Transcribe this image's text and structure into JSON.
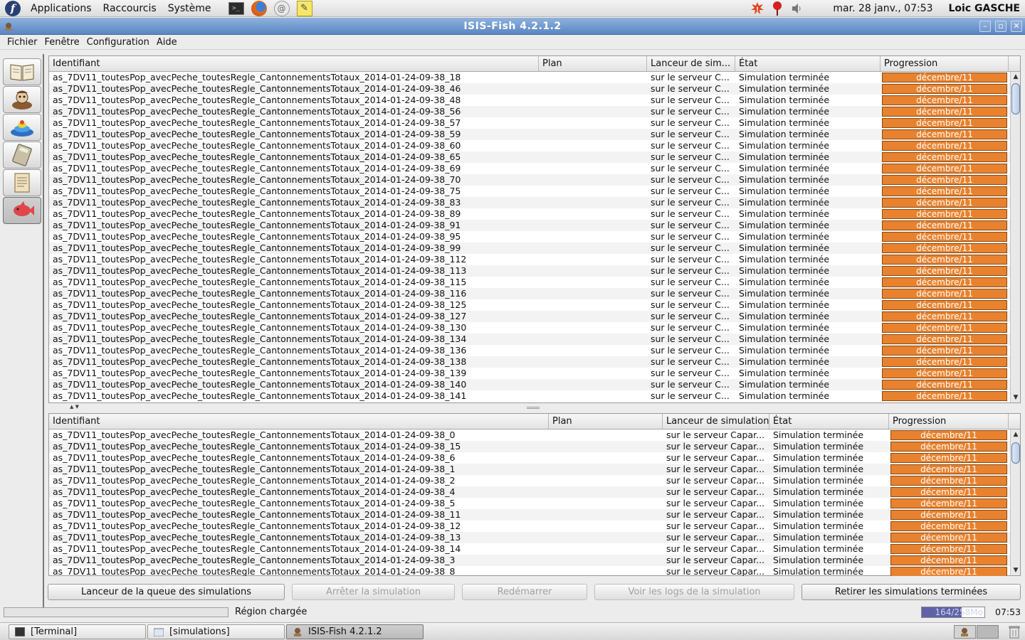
{
  "top_panel": {
    "menus": [
      "Applications",
      "Raccourcis",
      "Système"
    ],
    "launchers": [
      "terminal-icon",
      "firefox-icon",
      "mail-icon",
      "notes-icon"
    ],
    "tray": [
      "update-alert-icon",
      "notification-icon",
      "volume-icon"
    ],
    "clock": "mar. 28 janv., 07:53",
    "user": "Loic GASCHE"
  },
  "window": {
    "title": "ISIS-Fish 4.2.1.2"
  },
  "menubar": [
    "Fichier",
    "Fenêtre",
    "Configuration",
    "Aide"
  ],
  "toolbar": [
    "book-icon",
    "fisherman-icon",
    "sea-map-icon",
    "calculator-icon",
    "report-icon",
    "fish-icon"
  ],
  "top_table": {
    "headers": [
      "Identifiant",
      "Plan",
      "Lanceur de sim...",
      "État",
      "Progression"
    ],
    "rows": [
      [
        "as_7DV11_toutesPop_avecPeche_toutesRegle_CantonnementsTotaux_2014-01-24-09-38_18",
        "",
        "sur le serveur C...",
        "Simulation terminée",
        "décembre/11"
      ],
      [
        "as_7DV11_toutesPop_avecPeche_toutesRegle_CantonnementsTotaux_2014-01-24-09-38_46",
        "",
        "sur le serveur C...",
        "Simulation terminée",
        "décembre/11"
      ],
      [
        "as_7DV11_toutesPop_avecPeche_toutesRegle_CantonnementsTotaux_2014-01-24-09-38_48",
        "",
        "sur le serveur C...",
        "Simulation terminée",
        "décembre/11"
      ],
      [
        "as_7DV11_toutesPop_avecPeche_toutesRegle_CantonnementsTotaux_2014-01-24-09-38_56",
        "",
        "sur le serveur C...",
        "Simulation terminée",
        "décembre/11"
      ],
      [
        "as_7DV11_toutesPop_avecPeche_toutesRegle_CantonnementsTotaux_2014-01-24-09-38_57",
        "",
        "sur le serveur C...",
        "Simulation terminée",
        "décembre/11"
      ],
      [
        "as_7DV11_toutesPop_avecPeche_toutesRegle_CantonnementsTotaux_2014-01-24-09-38_59",
        "",
        "sur le serveur C...",
        "Simulation terminée",
        "décembre/11"
      ],
      [
        "as_7DV11_toutesPop_avecPeche_toutesRegle_CantonnementsTotaux_2014-01-24-09-38_60",
        "",
        "sur le serveur C...",
        "Simulation terminée",
        "décembre/11"
      ],
      [
        "as_7DV11_toutesPop_avecPeche_toutesRegle_CantonnementsTotaux_2014-01-24-09-38_65",
        "",
        "sur le serveur C...",
        "Simulation terminée",
        "décembre/11"
      ],
      [
        "as_7DV11_toutesPop_avecPeche_toutesRegle_CantonnementsTotaux_2014-01-24-09-38_69",
        "",
        "sur le serveur C...",
        "Simulation terminée",
        "décembre/11"
      ],
      [
        "as_7DV11_toutesPop_avecPeche_toutesRegle_CantonnementsTotaux_2014-01-24-09-38_70",
        "",
        "sur le serveur C...",
        "Simulation terminée",
        "décembre/11"
      ],
      [
        "as_7DV11_toutesPop_avecPeche_toutesRegle_CantonnementsTotaux_2014-01-24-09-38_75",
        "",
        "sur le serveur C...",
        "Simulation terminée",
        "décembre/11"
      ],
      [
        "as_7DV11_toutesPop_avecPeche_toutesRegle_CantonnementsTotaux_2014-01-24-09-38_83",
        "",
        "sur le serveur C...",
        "Simulation terminée",
        "décembre/11"
      ],
      [
        "as_7DV11_toutesPop_avecPeche_toutesRegle_CantonnementsTotaux_2014-01-24-09-38_89",
        "",
        "sur le serveur C...",
        "Simulation terminée",
        "décembre/11"
      ],
      [
        "as_7DV11_toutesPop_avecPeche_toutesRegle_CantonnementsTotaux_2014-01-24-09-38_91",
        "",
        "sur le serveur C...",
        "Simulation terminée",
        "décembre/11"
      ],
      [
        "as_7DV11_toutesPop_avecPeche_toutesRegle_CantonnementsTotaux_2014-01-24-09-38_95",
        "",
        "sur le serveur C...",
        "Simulation terminée",
        "décembre/11"
      ],
      [
        "as_7DV11_toutesPop_avecPeche_toutesRegle_CantonnementsTotaux_2014-01-24-09-38_99",
        "",
        "sur le serveur C...",
        "Simulation terminée",
        "décembre/11"
      ],
      [
        "as_7DV11_toutesPop_avecPeche_toutesRegle_CantonnementsTotaux_2014-01-24-09-38_112",
        "",
        "sur le serveur C...",
        "Simulation terminée",
        "décembre/11"
      ],
      [
        "as_7DV11_toutesPop_avecPeche_toutesRegle_CantonnementsTotaux_2014-01-24-09-38_113",
        "",
        "sur le serveur C...",
        "Simulation terminée",
        "décembre/11"
      ],
      [
        "as_7DV11_toutesPop_avecPeche_toutesRegle_CantonnementsTotaux_2014-01-24-09-38_115",
        "",
        "sur le serveur C...",
        "Simulation terminée",
        "décembre/11"
      ],
      [
        "as_7DV11_toutesPop_avecPeche_toutesRegle_CantonnementsTotaux_2014-01-24-09-38_116",
        "",
        "sur le serveur C...",
        "Simulation terminée",
        "décembre/11"
      ],
      [
        "as_7DV11_toutesPop_avecPeche_toutesRegle_CantonnementsTotaux_2014-01-24-09-38_125",
        "",
        "sur le serveur C...",
        "Simulation terminée",
        "décembre/11"
      ],
      [
        "as_7DV11_toutesPop_avecPeche_toutesRegle_CantonnementsTotaux_2014-01-24-09-38_127",
        "",
        "sur le serveur C...",
        "Simulation terminée",
        "décembre/11"
      ],
      [
        "as_7DV11_toutesPop_avecPeche_toutesRegle_CantonnementsTotaux_2014-01-24-09-38_130",
        "",
        "sur le serveur C...",
        "Simulation terminée",
        "décembre/11"
      ],
      [
        "as_7DV11_toutesPop_avecPeche_toutesRegle_CantonnementsTotaux_2014-01-24-09-38_134",
        "",
        "sur le serveur C...",
        "Simulation terminée",
        "décembre/11"
      ],
      [
        "as_7DV11_toutesPop_avecPeche_toutesRegle_CantonnementsTotaux_2014-01-24-09-38_136",
        "",
        "sur le serveur C...",
        "Simulation terminée",
        "décembre/11"
      ],
      [
        "as_7DV11_toutesPop_avecPeche_toutesRegle_CantonnementsTotaux_2014-01-24-09-38_138",
        "",
        "sur le serveur C...",
        "Simulation terminée",
        "décembre/11"
      ],
      [
        "as_7DV11_toutesPop_avecPeche_toutesRegle_CantonnementsTotaux_2014-01-24-09-38_139",
        "",
        "sur le serveur C...",
        "Simulation terminée",
        "décembre/11"
      ],
      [
        "as_7DV11_toutesPop_avecPeche_toutesRegle_CantonnementsTotaux_2014-01-24-09-38_140",
        "",
        "sur le serveur C...",
        "Simulation terminée",
        "décembre/11"
      ],
      [
        "as_7DV11_toutesPop_avecPeche_toutesRegle_CantonnementsTotaux_2014-01-24-09-38_141",
        "",
        "sur le serveur C...",
        "Simulation terminée",
        "décembre/11"
      ]
    ]
  },
  "bottom_table": {
    "headers": [
      "Identifiant",
      "Plan",
      "Lanceur de simulation",
      "État",
      "Progression"
    ],
    "rows": [
      [
        "as_7DV11_toutesPop_avecPeche_toutesRegle_CantonnementsTotaux_2014-01-24-09-38_0",
        "",
        "sur le serveur Capar...",
        "Simulation terminée",
        "décembre/11"
      ],
      [
        "as_7DV11_toutesPop_avecPeche_toutesRegle_CantonnementsTotaux_2014-01-24-09-38_15",
        "",
        "sur le serveur Capar...",
        "Simulation terminée",
        "décembre/11"
      ],
      [
        "as_7DV11_toutesPop_avecPeche_toutesRegle_CantonnementsTotaux_2014-01-24-09-38_6",
        "",
        "sur le serveur Capar...",
        "Simulation terminée",
        "décembre/11"
      ],
      [
        "as_7DV11_toutesPop_avecPeche_toutesRegle_CantonnementsTotaux_2014-01-24-09-38_1",
        "",
        "sur le serveur Capar...",
        "Simulation terminée",
        "décembre/11"
      ],
      [
        "as_7DV11_toutesPop_avecPeche_toutesRegle_CantonnementsTotaux_2014-01-24-09-38_2",
        "",
        "sur le serveur Capar...",
        "Simulation terminée",
        "décembre/11"
      ],
      [
        "as_7DV11_toutesPop_avecPeche_toutesRegle_CantonnementsTotaux_2014-01-24-09-38_4",
        "",
        "sur le serveur Capar...",
        "Simulation terminée",
        "décembre/11"
      ],
      [
        "as_7DV11_toutesPop_avecPeche_toutesRegle_CantonnementsTotaux_2014-01-24-09-38_5",
        "",
        "sur le serveur Capar...",
        "Simulation terminée",
        "décembre/11"
      ],
      [
        "as_7DV11_toutesPop_avecPeche_toutesRegle_CantonnementsTotaux_2014-01-24-09-38_11",
        "",
        "sur le serveur Capar...",
        "Simulation terminée",
        "décembre/11"
      ],
      [
        "as_7DV11_toutesPop_avecPeche_toutesRegle_CantonnementsTotaux_2014-01-24-09-38_12",
        "",
        "sur le serveur Capar...",
        "Simulation terminée",
        "décembre/11"
      ],
      [
        "as_7DV11_toutesPop_avecPeche_toutesRegle_CantonnementsTotaux_2014-01-24-09-38_13",
        "",
        "sur le serveur Capar...",
        "Simulation terminée",
        "décembre/11"
      ],
      [
        "as_7DV11_toutesPop_avecPeche_toutesRegle_CantonnementsTotaux_2014-01-24-09-38_14",
        "",
        "sur le serveur Capar...",
        "Simulation terminée",
        "décembre/11"
      ],
      [
        "as_7DV11_toutesPop_avecPeche_toutesRegle_CantonnementsTotaux_2014-01-24-09-38_3",
        "",
        "sur le serveur Capar...",
        "Simulation terminée",
        "décembre/11"
      ],
      [
        "as_7DV11_toutesPop_avecPeche_toutesRegle_CantonnementsTotaux_2014-01-24-09-38_8",
        "",
        "sur le serveur Capar...",
        "Simulation terminée",
        "décembre/11"
      ]
    ]
  },
  "buttons": {
    "queue_launcher": "Lanceur de la queue des simulations",
    "stop": "Arrêter la simulation",
    "restart": "Redémarrer",
    "logs": "Voir les logs de la simulation",
    "remove_finished": "Retirer les simulations terminées"
  },
  "status": {
    "message": "Région chargée",
    "memory": "164/258Mo",
    "memory_fraction": 0.636,
    "time": "07:53"
  },
  "taskbar": {
    "items": [
      "[Terminal]",
      "[simulations]",
      "ISIS-Fish 4.2.1.2"
    ]
  },
  "colors": {
    "progress": "#e8822e",
    "titlebar": "#6b93cc",
    "memory": "#5f62a8"
  }
}
